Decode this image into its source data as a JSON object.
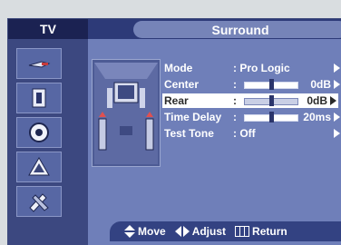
{
  "header": {
    "tv_label": "TV",
    "title": "Surround"
  },
  "sidebar": {
    "items": [
      {
        "icon": "antenna-icon",
        "active": false
      },
      {
        "icon": "speaker-icon",
        "active": false
      },
      {
        "icon": "disc-icon",
        "active": false
      },
      {
        "icon": "function-icon",
        "active": false
      },
      {
        "icon": "tools-icon",
        "active": false
      }
    ]
  },
  "menu": {
    "mode": {
      "label": "Mode",
      "value": ": Pro Logic"
    },
    "center": {
      "label": "Center",
      "value": ":",
      "amount": "0dB",
      "level": 0.5
    },
    "rear": {
      "label": "Rear",
      "value": ":",
      "amount": "0dB",
      "level": 0.5
    },
    "time_delay": {
      "label": "Time Delay",
      "value": ":",
      "amount": "20ms",
      "level": 0.5
    },
    "test_tone": {
      "label": "Test Tone",
      "value": ": Off"
    }
  },
  "footer": {
    "move": "Move",
    "adjust": "Adjust",
    "return": "Return"
  },
  "colors": {
    "screen_bg": "#6f7fb9",
    "sidebar_bg": "#3c4880",
    "title_pill": "#7684b8"
  }
}
